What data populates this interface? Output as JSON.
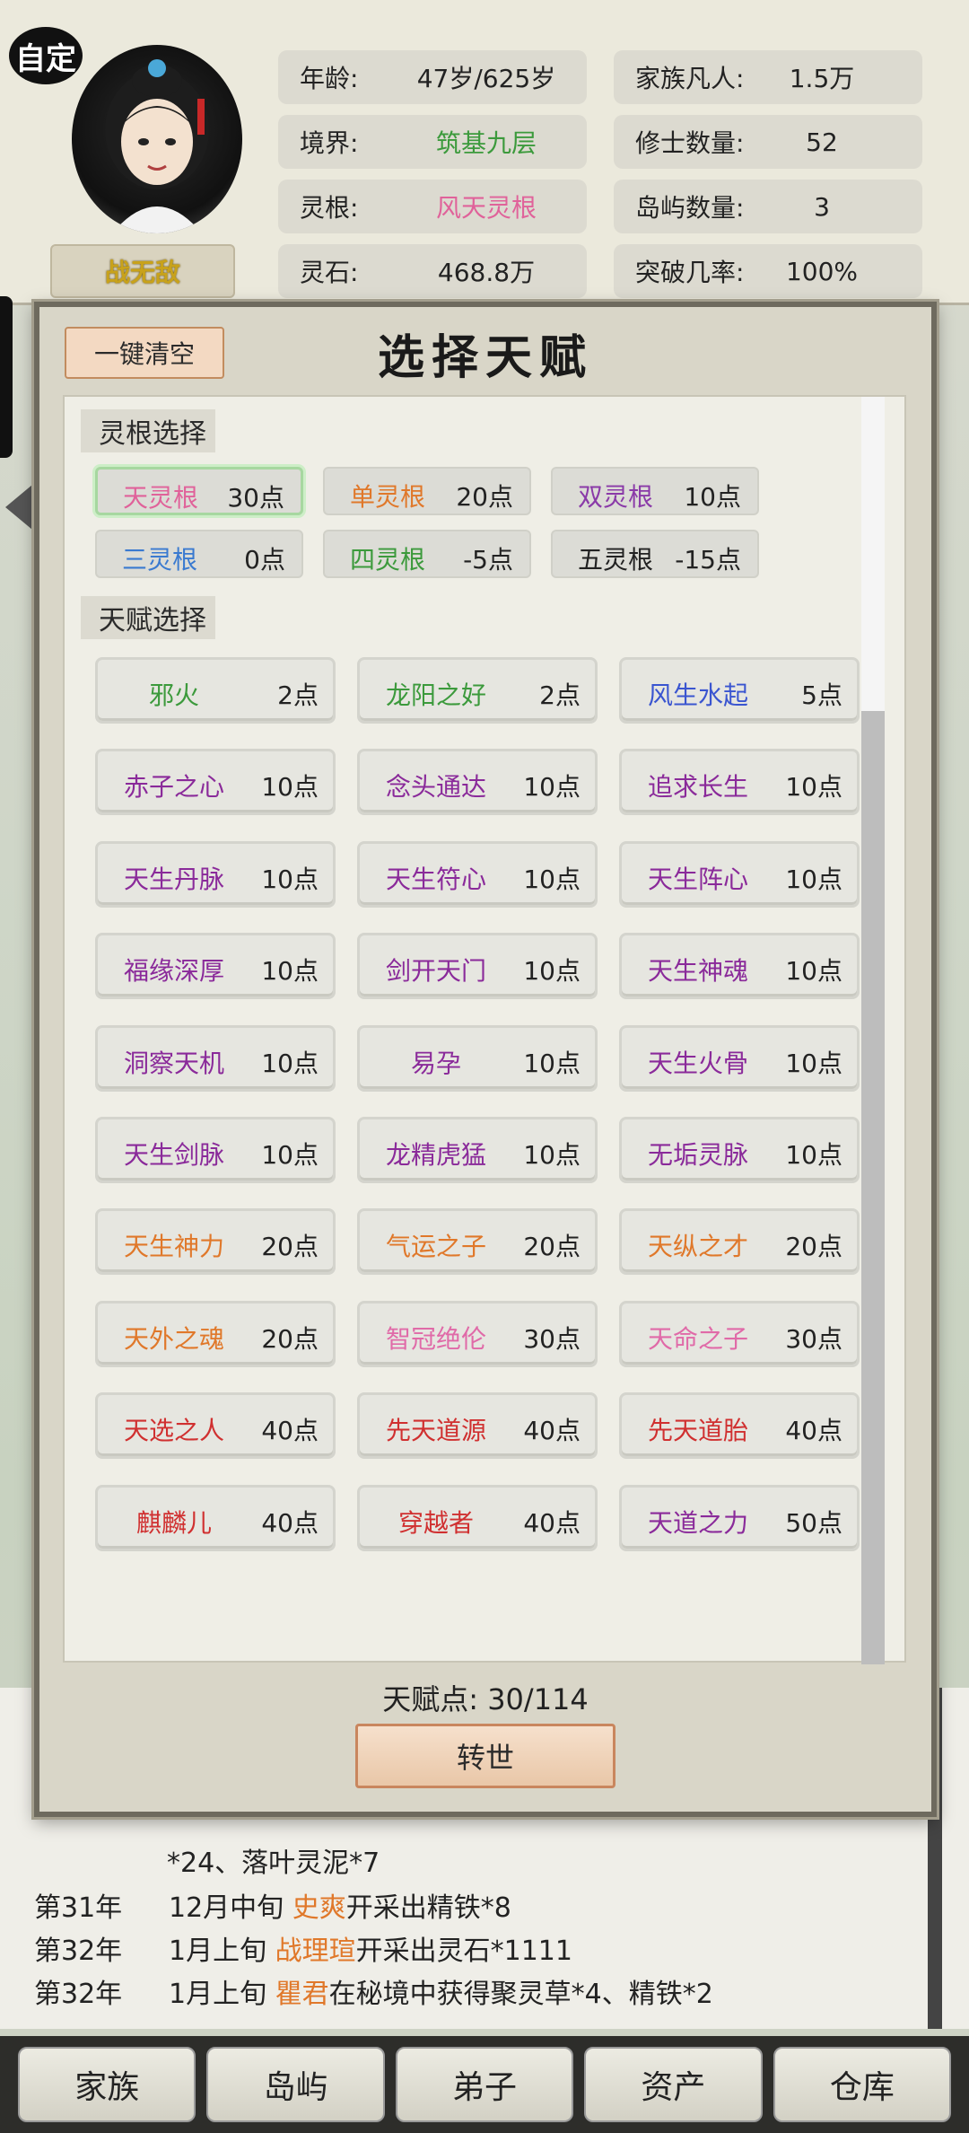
{
  "header": {
    "custom_badge": "自定",
    "name": "战无敌",
    "stats": [
      {
        "label": "年龄:",
        "value": "47岁/625岁",
        "color": "#222222"
      },
      {
        "label": "家族凡人:",
        "value": "1.5万",
        "color": "#222222"
      },
      {
        "label": "境界:",
        "value": "筑基九层",
        "color": "#3c9a3c"
      },
      {
        "label": "修士数量:",
        "value": "52",
        "color": "#222222"
      },
      {
        "label": "灵根:",
        "value": "风天灵根",
        "color": "#e0629a"
      },
      {
        "label": "岛屿数量:",
        "value": "3",
        "color": "#222222"
      },
      {
        "label": "灵石:",
        "value": "468.8万",
        "color": "#222222"
      },
      {
        "label": "突破几率:",
        "value": "100%",
        "color": "#222222"
      }
    ]
  },
  "modal": {
    "clear_button": "一键清空",
    "title": "选择天赋",
    "root_section_title": "灵根选择",
    "talent_section_title": "天赋选择",
    "roots": [
      {
        "name": "天灵根",
        "points": "30点",
        "color": "#e0629a",
        "selected": true
      },
      {
        "name": "单灵根",
        "points": "20点",
        "color": "#e0782a",
        "selected": false
      },
      {
        "name": "双灵根",
        "points": "10点",
        "color": "#8a3aa8",
        "selected": false
      },
      {
        "name": "三灵根",
        "points": "0点",
        "color": "#3a7ad0",
        "selected": false
      },
      {
        "name": "四灵根",
        "points": "-5点",
        "color": "#3c9a3c",
        "selected": false
      },
      {
        "name": "五灵根",
        "points": "-15点",
        "color": "#222222",
        "selected": false
      }
    ],
    "talents": [
      {
        "name": "邪火",
        "points": "2点",
        "color": "#3c9a3c"
      },
      {
        "name": "龙阳之好",
        "points": "2点",
        "color": "#3c9a3c"
      },
      {
        "name": "风生水起",
        "points": "5点",
        "color": "#3a55d0"
      },
      {
        "name": "赤子之心",
        "points": "10点",
        "color": "#8a2a9a"
      },
      {
        "name": "念头通达",
        "points": "10点",
        "color": "#8a2a9a"
      },
      {
        "name": "追求长生",
        "points": "10点",
        "color": "#8a2a9a"
      },
      {
        "name": "天生丹脉",
        "points": "10点",
        "color": "#8a2a9a"
      },
      {
        "name": "天生符心",
        "points": "10点",
        "color": "#8a2a9a"
      },
      {
        "name": "天生阵心",
        "points": "10点",
        "color": "#8a2a9a"
      },
      {
        "name": "福缘深厚",
        "points": "10点",
        "color": "#8a2a9a"
      },
      {
        "name": "剑开天门",
        "points": "10点",
        "color": "#8a2a9a"
      },
      {
        "name": "天生神魂",
        "points": "10点",
        "color": "#8a2a9a"
      },
      {
        "name": "洞察天机",
        "points": "10点",
        "color": "#8a2a9a"
      },
      {
        "name": "易孕",
        "points": "10点",
        "color": "#8a2a9a"
      },
      {
        "name": "天生火骨",
        "points": "10点",
        "color": "#8a2a9a"
      },
      {
        "name": "天生剑脉",
        "points": "10点",
        "color": "#8a2a9a"
      },
      {
        "name": "龙精虎猛",
        "points": "10点",
        "color": "#8a2a9a"
      },
      {
        "name": "无垢灵脉",
        "points": "10点",
        "color": "#8a2a9a"
      },
      {
        "name": "天生神力",
        "points": "20点",
        "color": "#e0782a"
      },
      {
        "name": "气运之子",
        "points": "20点",
        "color": "#e0782a"
      },
      {
        "name": "天纵之才",
        "points": "20点",
        "color": "#e0782a"
      },
      {
        "name": "天外之魂",
        "points": "20点",
        "color": "#e0782a"
      },
      {
        "name": "智冠绝伦",
        "points": "30点",
        "color": "#e06aa8"
      },
      {
        "name": "天命之子",
        "points": "30点",
        "color": "#e06aa8"
      },
      {
        "name": "天选之人",
        "points": "40点",
        "color": "#d03030"
      },
      {
        "name": "先天道源",
        "points": "40点",
        "color": "#d03030"
      },
      {
        "name": "先天道胎",
        "points": "40点",
        "color": "#d03030"
      },
      {
        "name": "麒麟儿",
        "points": "40点",
        "color": "#d03030"
      },
      {
        "name": "穿越者",
        "points": "40点",
        "color": "#d03030"
      },
      {
        "name": "天道之力",
        "points": "50点",
        "color": "#8a2a9a"
      }
    ],
    "points_label": "天赋点:",
    "points_value": "30/114",
    "reincarnate_button": "转世"
  },
  "log": [
    {
      "year": "",
      "text_before": "*24、落叶灵泥*7",
      "highlight": "",
      "text_after": ""
    },
    {
      "year": "第31年",
      "text_before": "12月中旬 ",
      "highlight": "史爽",
      "text_after": "开采出精铁*8"
    },
    {
      "year": "第32年",
      "text_before": "1月上旬 ",
      "highlight": "战理瑄",
      "text_after": "开采出灵石*1111"
    },
    {
      "year": "第32年",
      "text_before": "1月上旬 ",
      "highlight": "瞿君",
      "text_after": "在秘境中获得聚灵草*4、精铁*2"
    }
  ],
  "bottom_nav": [
    "家族",
    "岛屿",
    "弟子",
    "资产",
    "仓库"
  ]
}
